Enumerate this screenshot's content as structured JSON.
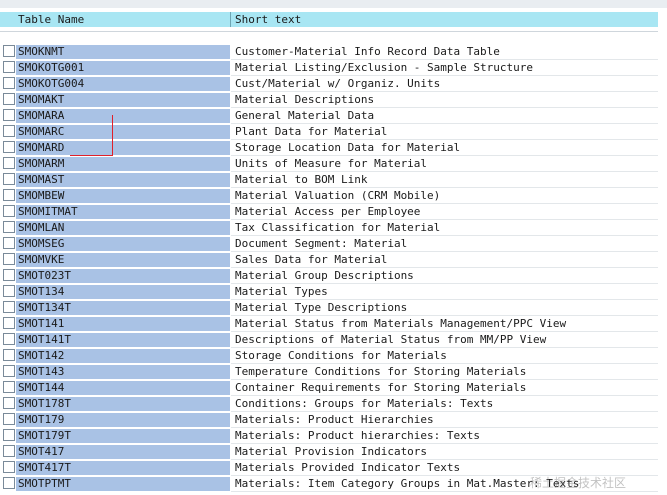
{
  "header": {
    "table_name": "Table Name",
    "short_text": "Short text"
  },
  "rows": [
    {
      "name": "SMOKNMT",
      "text": "Customer-Material Info Record Data Table"
    },
    {
      "name": "SMOKOTG001",
      "text": "Material Listing/Exclusion - Sample Structure"
    },
    {
      "name": "SMOKOTG004",
      "text": "Cust/Material w/ Organiz. Units"
    },
    {
      "name": "SMOMAKT",
      "text": "Material Descriptions"
    },
    {
      "name": "SMOMARA",
      "text": "General Material Data"
    },
    {
      "name": "SMOMARC",
      "text": "Plant Data for Material"
    },
    {
      "name": "SMOMARD",
      "text": "Storage Location Data for Material"
    },
    {
      "name": "SMOMARM",
      "text": "Units of Measure for Material"
    },
    {
      "name": "SMOMAST",
      "text": "Material to BOM Link"
    },
    {
      "name": "SMOMBEW",
      "text": "Material Valuation (CRM Mobile)"
    },
    {
      "name": "SMOMITMAT",
      "text": "Material Access per Employee"
    },
    {
      "name": "SMOMLAN",
      "text": "Tax Classification for Material"
    },
    {
      "name": "SMOMSEG",
      "text": "Document Segment: Material"
    },
    {
      "name": "SMOMVKE",
      "text": "Sales Data for Material"
    },
    {
      "name": "SMOT023T",
      "text": "Material Group Descriptions"
    },
    {
      "name": "SMOT134",
      "text": "Material Types"
    },
    {
      "name": "SMOT134T",
      "text": "Material Type Descriptions"
    },
    {
      "name": "SMOT141",
      "text": "Material Status from Materials Management/PPC View"
    },
    {
      "name": "SMOT141T",
      "text": "Descriptions of Material Status from MM/PP View"
    },
    {
      "name": "SMOT142",
      "text": "Storage Conditions for Materials"
    },
    {
      "name": "SMOT143",
      "text": "Temperature Conditions for Storing Materials"
    },
    {
      "name": "SMOT144",
      "text": "Container Requirements for Storing Materials"
    },
    {
      "name": "SMOT178T",
      "text": "Conditions: Groups for Materials: Texts"
    },
    {
      "name": "SMOT179",
      "text": "Materials: Product Hierarchies"
    },
    {
      "name": "SMOT179T",
      "text": "Materials: Product hierarchies: Texts"
    },
    {
      "name": "SMOT417",
      "text": "Material Provision Indicators"
    },
    {
      "name": "SMOT417T",
      "text": "Materials Provided Indicator Texts"
    },
    {
      "name": "SMOTPTMT",
      "text": "Materials: Item Category Groups in Mat.Master: Texts"
    }
  ],
  "watermark": "稀土掘金技术社区",
  "colors": {
    "header_bg": "#a8e6f3",
    "name_bg": "#a9c2e5",
    "annotation": "#e0202a"
  }
}
